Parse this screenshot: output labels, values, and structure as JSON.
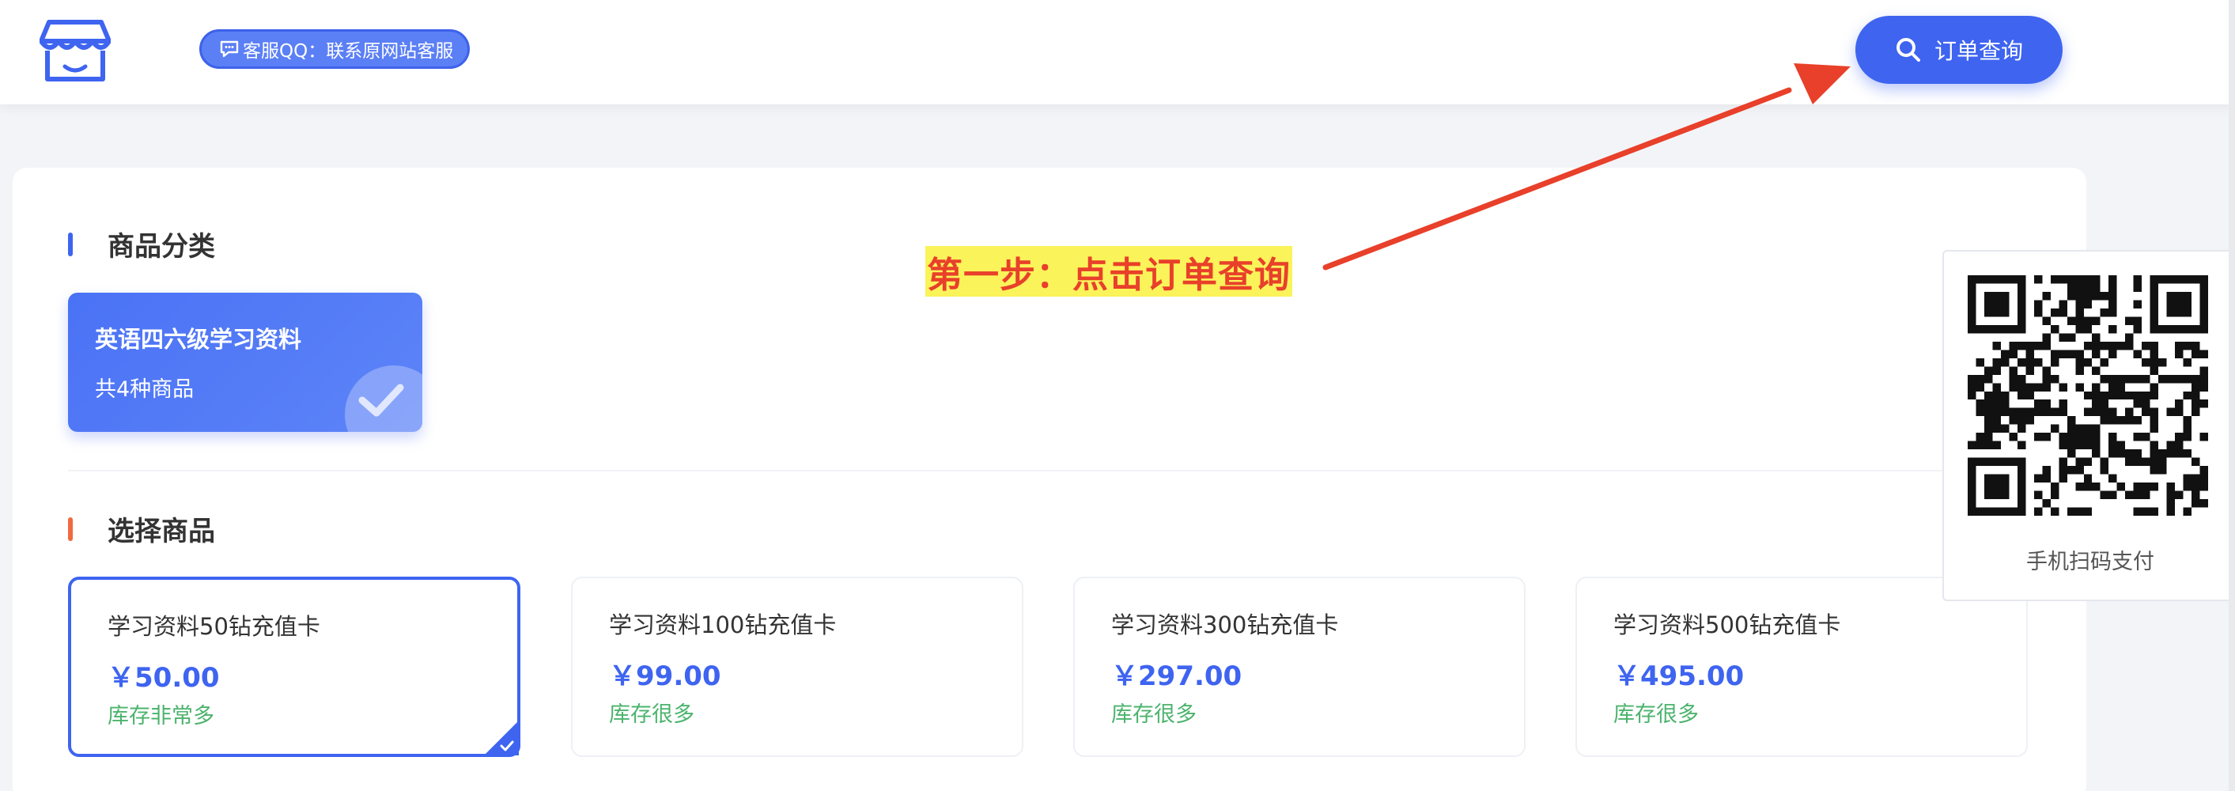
{
  "header": {
    "qq_badge": "客服QQ：联系原网站客服",
    "order_query": "订单查询"
  },
  "categories": {
    "title": "商品分类",
    "bar_color": "#3e64f0",
    "items": [
      {
        "name": "英语四六级学习资料",
        "count": "共4种商品"
      }
    ]
  },
  "products": {
    "title": "选择商品",
    "bar_color": "#f06a3d",
    "items": [
      {
        "name": "学习资料50钻充值卡",
        "price": "￥50.00",
        "stock": "库存非常多"
      },
      {
        "name": "学习资料100钻充值卡",
        "price": "￥99.00",
        "stock": "库存很多"
      },
      {
        "name": "学习资料300钻充值卡",
        "price": "￥297.00",
        "stock": "库存很多"
      },
      {
        "name": "学习资料500钻充值卡",
        "price": "￥495.00",
        "stock": "库存很多"
      }
    ]
  },
  "annotation": {
    "step": "第一步：点击订单查询"
  },
  "qr": {
    "caption": "手机扫码支付"
  },
  "colors": {
    "accent": "#3e64f0",
    "price": "#3e64f0",
    "stock": "#4cb36d",
    "annotation_text": "#e8402a",
    "annotation_bg": "#fbf35a"
  }
}
